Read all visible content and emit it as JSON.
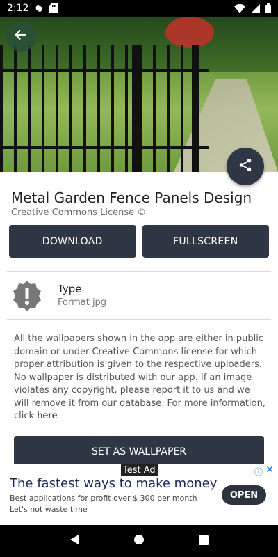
{
  "status_bar": {
    "time": "2:12",
    "icons": [
      "gear-icon",
      "sd-card-icon",
      "wifi-icon",
      "signal-icon",
      "battery-icon"
    ]
  },
  "wallpaper": {
    "title": "Metal Garden Fence Panels Design",
    "license": "Creative Commons License ©"
  },
  "actions": {
    "download_label": "DOWNLOAD",
    "fullscreen_label": "FULLSCREEN",
    "set_wallpaper_label": "SET AS WALLPAPER"
  },
  "type_info": {
    "label": "Type",
    "value": "Format jpg",
    "icon": "alert-badge-icon"
  },
  "description": {
    "text": "All the wallpapers shown in the app are either in public domain or under Creative Commons license for which proper attribution is given to the respective uploaders. No wallpaper is distributed with our app. If an image violates any copyright, please report it to us and we will remove it from our database. For more information, click",
    "link": "here"
  },
  "ad": {
    "badge": "Test Ad",
    "headline": "The fastest ways to make money",
    "body": "Best applications for profit over $ 300 per month Let's not waste time",
    "cta": "OPEN",
    "info_icon": "ⓘ",
    "close_icon": "✕"
  },
  "colors": {
    "accent_dark": "#2f3744",
    "ad_link": "#1a73e8"
  }
}
